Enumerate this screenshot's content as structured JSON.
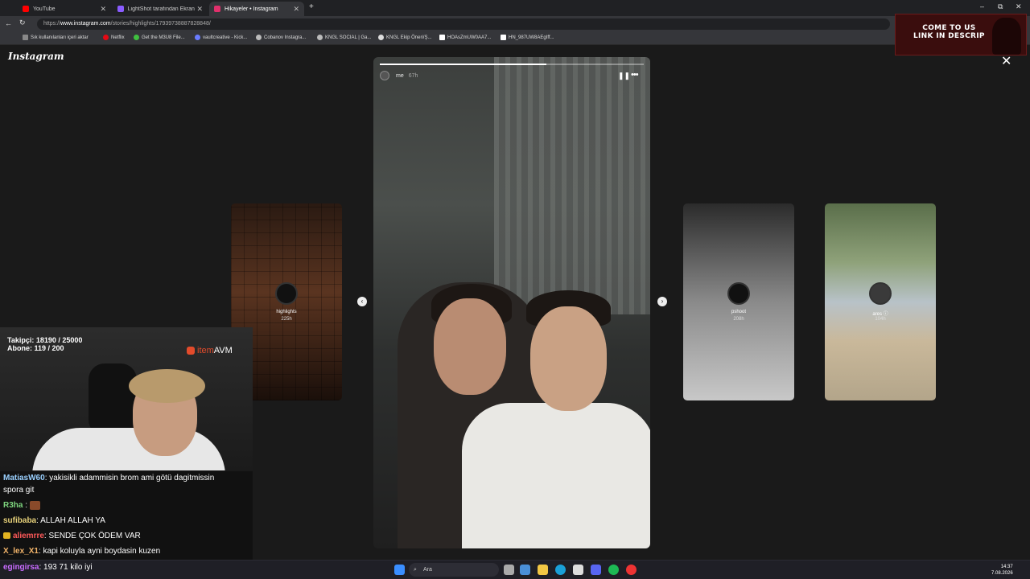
{
  "browser": {
    "tabs": [
      {
        "label": "YouTube",
        "color": "#ff0000"
      },
      {
        "label": "LightShot tarafından Ekran Görün",
        "color": "#8a5cff"
      },
      {
        "label": "Hikayeler • Instagram",
        "color": "#e1306c"
      }
    ],
    "new_tab": "+",
    "url_prefix": "https://",
    "url_domain": "www.instagram.com",
    "url_path": "/stories/highlights/17939738887828848/",
    "window_controls": [
      "–",
      "⧉",
      "✕"
    ],
    "bookmarks": [
      "Sık kullanılanları içeri aktar",
      "Netflix",
      "Get the M3U8 File...",
      "vaultcreative - Kick...",
      "Cobanov Instagra...",
      "KNGL SOCIAL | Ga...",
      "KNGL Ekip Öneri/Ş...",
      "HOAsZmUW0AA7...",
      "HN_987UW8AEgIff..."
    ]
  },
  "promo": {
    "line1": "COME TO US",
    "line2": "LINK IN DESCRIP"
  },
  "instagram": {
    "logo": "Instagram",
    "close": "✕",
    "story": {
      "username": "me",
      "time": "67h",
      "progress": 0.63,
      "pause": "❚❚",
      "more": "•••"
    },
    "prev_highlight": {
      "label": "highlights",
      "time": "225h"
    },
    "next_highlights": [
      {
        "label": "pshoot",
        "time": "208h"
      },
      {
        "label": "ares ⓘ",
        "time": "104h"
      }
    ],
    "prev_arrow": "‹",
    "next_arrow": "›"
  },
  "stream": {
    "followers": "Takipçi: 18190 / 25000",
    "subs": "Abone: 119 / 200",
    "sponsor_item": "item",
    "sponsor_avm": "AVM"
  },
  "chat": [
    {
      "user": "MatiasW60",
      "color": "#9ad0ff",
      "text": ": yakisikli adammisin brom ami götü dagitmissin"
    },
    {
      "user": "",
      "color": "#ffffff",
      "text": "spora git"
    },
    {
      "user": "R3ha",
      "color": "#7fd67f",
      "text": " : "
    },
    {
      "user": "sufibaba",
      "color": "#e8d27a",
      "text": ": ALLAH ALLAH YA"
    },
    {
      "user": "aliemrre",
      "color": "#ff5a5a",
      "text": ": SENDE ÇOK ÖDEM VAR"
    },
    {
      "user": "X_lex_X1",
      "color": "#f2b46a",
      "text": ": kapi koluyla ayni boydasin kuzen"
    },
    {
      "user": "egingirsa",
      "color": "#c96cff",
      "text": ": 193 71 kilo iyi"
    }
  ],
  "taskbar": {
    "search": "Ara",
    "time": "14:37",
    "date": "7.08.2026"
  }
}
